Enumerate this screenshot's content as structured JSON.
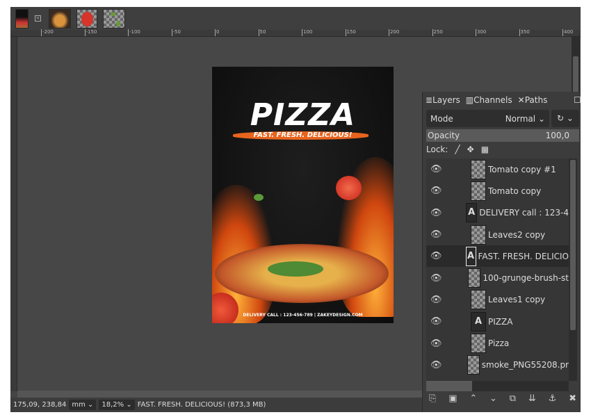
{
  "image_tabs": [
    {
      "name": "pizza-poster",
      "active": true
    },
    {
      "name": "pizza"
    },
    {
      "name": "tomato"
    },
    {
      "name": "leaves"
    }
  ],
  "ruler": {
    "labels": [
      "-200",
      "-150",
      "-100",
      "-50",
      "0",
      "50",
      "100",
      "150",
      "200",
      "250",
      "300",
      "350",
      "400"
    ]
  },
  "poster": {
    "title": "PIZZA",
    "tagline": "FAST. FRESH. DELICIOUS!",
    "footer": "DELIVERY CALL : 123-456-789 | ZAKEYDESIGN.COM"
  },
  "status": {
    "coords": "175,09, 238,84",
    "unit": "mm",
    "zoom": "18,2%",
    "message": "FAST. FRESH. DELICIOUS! (873,3 MB)"
  },
  "dock": {
    "tabs": [
      "Layers",
      "Channels",
      "Paths"
    ],
    "mode_label": "Mode",
    "mode_value": "Normal",
    "opacity_label": "Opacity",
    "opacity_value": "100,0",
    "lock_label": "Lock:",
    "layers": [
      {
        "name": "Tomato copy #1",
        "type": "image"
      },
      {
        "name": "Tomato copy",
        "type": "image"
      },
      {
        "name": "DELIVERY call : 123-4",
        "type": "text"
      },
      {
        "name": "Leaves2 copy",
        "type": "image"
      },
      {
        "name": "FAST. FRESH. DELICIO",
        "type": "text",
        "selected": true
      },
      {
        "name": "100-grunge-brush-st",
        "type": "image"
      },
      {
        "name": "Leaves1 copy",
        "type": "image"
      },
      {
        "name": "PIZZA",
        "type": "text"
      },
      {
        "name": "Pizza",
        "type": "image"
      },
      {
        "name": "smoke_PNG55208.pr",
        "type": "image"
      }
    ]
  },
  "colors": {
    "accent_orange": "#e8641e",
    "panel": "#3c3c3c",
    "canvas": "#474747"
  }
}
